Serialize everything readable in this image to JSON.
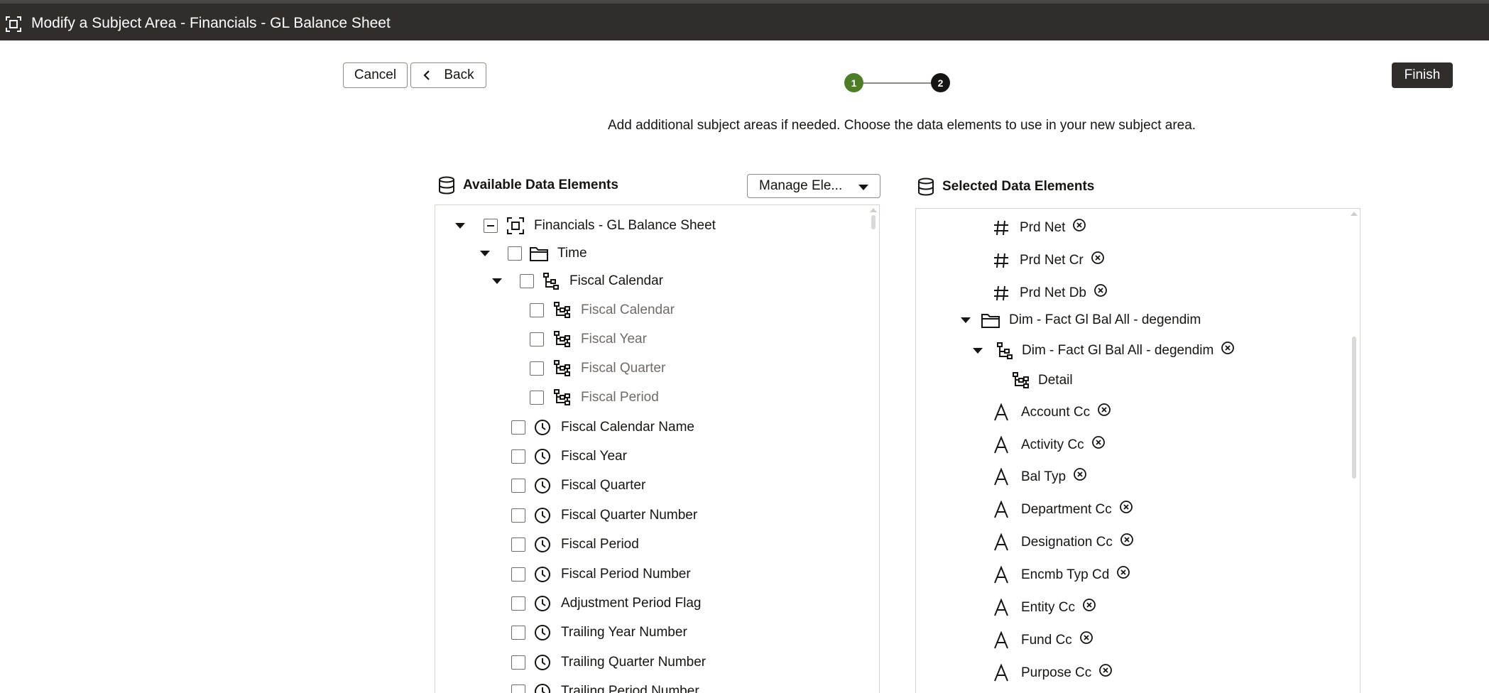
{
  "window": {
    "title": "Modify a Subject Area - Financials - GL Balance Sheet"
  },
  "toolbar": {
    "cancel_label": "Cancel",
    "back_label": "Back",
    "finish_label": "Finish"
  },
  "train": {
    "steps": [
      "1",
      "2"
    ],
    "completed_color": "#4e7d2a",
    "current_color": "#161513"
  },
  "instruction": "Add additional subject areas if needed. Choose the data elements to use in your new subject area.",
  "available": {
    "title": "Available Data Elements",
    "manage_label": "Manage Ele...",
    "tree": [
      {
        "label": "Financials - GL Balance Sheet",
        "icon": "subject-area-icon"
      },
      {
        "label": "Time",
        "icon": "folder-icon"
      },
      {
        "label": "Fiscal Calendar",
        "icon": "hierarchy-icon"
      },
      {
        "label": "Fiscal Calendar",
        "icon": "hierarchy-level-icon"
      },
      {
        "label": "Fiscal Year",
        "icon": "hierarchy-level-icon"
      },
      {
        "label": "Fiscal Quarter",
        "icon": "hierarchy-level-icon"
      },
      {
        "label": "Fiscal Period",
        "icon": "hierarchy-level-icon"
      },
      {
        "label": "Fiscal Calendar Name",
        "icon": "time-icon"
      },
      {
        "label": "Fiscal Year",
        "icon": "time-icon"
      },
      {
        "label": "Fiscal Quarter",
        "icon": "time-icon"
      },
      {
        "label": "Fiscal Quarter Number",
        "icon": "time-icon"
      },
      {
        "label": "Fiscal Period",
        "icon": "time-icon"
      },
      {
        "label": "Fiscal Period Number",
        "icon": "time-icon"
      },
      {
        "label": "Adjustment Period Flag",
        "icon": "time-icon"
      },
      {
        "label": "Trailing Year Number",
        "icon": "time-icon"
      },
      {
        "label": "Trailing Quarter Number",
        "icon": "time-icon"
      },
      {
        "label": "Trailing Period Number",
        "icon": "time-icon"
      }
    ]
  },
  "selected": {
    "title": "Selected Data Elements",
    "tree": [
      {
        "label": "Prd Net",
        "icon": "measure-icon"
      },
      {
        "label": "Prd Net Cr",
        "icon": "measure-icon"
      },
      {
        "label": "Prd Net Db",
        "icon": "measure-icon"
      },
      {
        "label": "Dim - Fact Gl Bal All - degendim",
        "icon": "folder-icon"
      },
      {
        "label": "Dim - Fact Gl Bal All - degendim",
        "icon": "hierarchy-icon"
      },
      {
        "label": "Detail",
        "icon": "hierarchy-level-icon"
      },
      {
        "label": "Account Cc",
        "icon": "attribute-icon"
      },
      {
        "label": "Activity Cc",
        "icon": "attribute-icon"
      },
      {
        "label": "Bal Typ",
        "icon": "attribute-icon"
      },
      {
        "label": "Department Cc",
        "icon": "attribute-icon"
      },
      {
        "label": "Designation Cc",
        "icon": "attribute-icon"
      },
      {
        "label": "Encmb Typ Cd",
        "icon": "attribute-icon"
      },
      {
        "label": "Entity Cc",
        "icon": "attribute-icon"
      },
      {
        "label": "Fund Cc",
        "icon": "attribute-icon"
      },
      {
        "label": "Purpose Cc",
        "icon": "attribute-icon"
      }
    ]
  }
}
